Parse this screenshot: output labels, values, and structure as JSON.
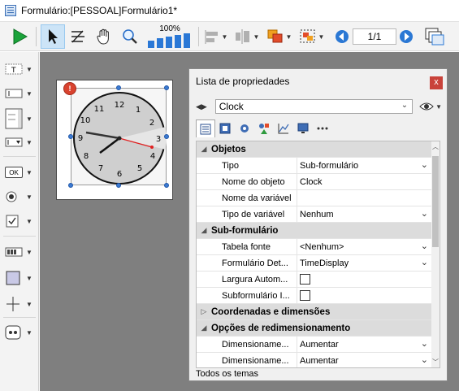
{
  "window": {
    "title": "Formulário:[PESSOAL]Formulário1*"
  },
  "toolbar": {
    "zoom_label": "100%",
    "page_indicator": "1/1",
    "icons": [
      "run-icon",
      "arrow-select-icon",
      "tab-order-icon",
      "hand-icon",
      "zoom-icon",
      "bars-icon",
      "align-icon",
      "distribute-icon",
      "level-icon",
      "group-icon",
      "prev-page-icon",
      "next-page-icon",
      "views-icon"
    ]
  },
  "palette": {
    "items": [
      "text-tool-icon",
      "field-tool-icon",
      "list-tool-icon",
      "combo-tool-icon",
      "button-tool-icon",
      "radio-tool-icon",
      "checkbox-tool-icon",
      "progress-tool-icon",
      "rectangle-tool-icon",
      "line-tool-icon",
      "plugin-tool-icon"
    ],
    "button_label": "OK"
  },
  "canvas": {
    "clock_numbers": [
      "12",
      "1",
      "2",
      "3",
      "4",
      "5",
      "6",
      "7",
      "8",
      "9",
      "10",
      "11"
    ],
    "badge_icon": "error-badge-icon"
  },
  "panel": {
    "title": "Lista de propriedades",
    "close": "x",
    "object_selector": "Clock",
    "tab_icons": [
      "list-tab-icon",
      "properties-tab-icon",
      "settings-tab-icon",
      "objects-tab-icon",
      "graph-tab-icon",
      "display-tab-icon",
      "more-tab-icon"
    ],
    "sections": [
      {
        "title": "Objetos",
        "rows": [
          {
            "name": "Tipo",
            "value": "Sub-formulário",
            "dropdown": true
          },
          {
            "name": "Nome do objeto",
            "value": "Clock",
            "dropdown": false
          },
          {
            "name": "Nome da variável",
            "value": "",
            "dropdown": false
          },
          {
            "name": "Tipo de variável",
            "value": "Nenhum",
            "dropdown": true
          }
        ]
      },
      {
        "title": "Sub-formulário",
        "rows": [
          {
            "name": "Tabela fonte",
            "value": "<Nenhum>",
            "dropdown": true
          },
          {
            "name": "Formulário Det...",
            "value": "TimeDisplay",
            "dropdown": true
          },
          {
            "name": "Largura Autom...",
            "checkbox": true
          },
          {
            "name": "Subformulário I...",
            "checkbox": true
          }
        ]
      },
      {
        "title": "Coordenadas e dimensões",
        "collapsed": true
      },
      {
        "title": "Opções de redimensionamento",
        "rows": [
          {
            "name": "Dimensioname...",
            "value": "Aumentar",
            "dropdown": true
          },
          {
            "name": "Dimensioname...",
            "value": "Aumentar",
            "dropdown": true
          }
        ]
      }
    ],
    "footer": "Todos os temas"
  }
}
